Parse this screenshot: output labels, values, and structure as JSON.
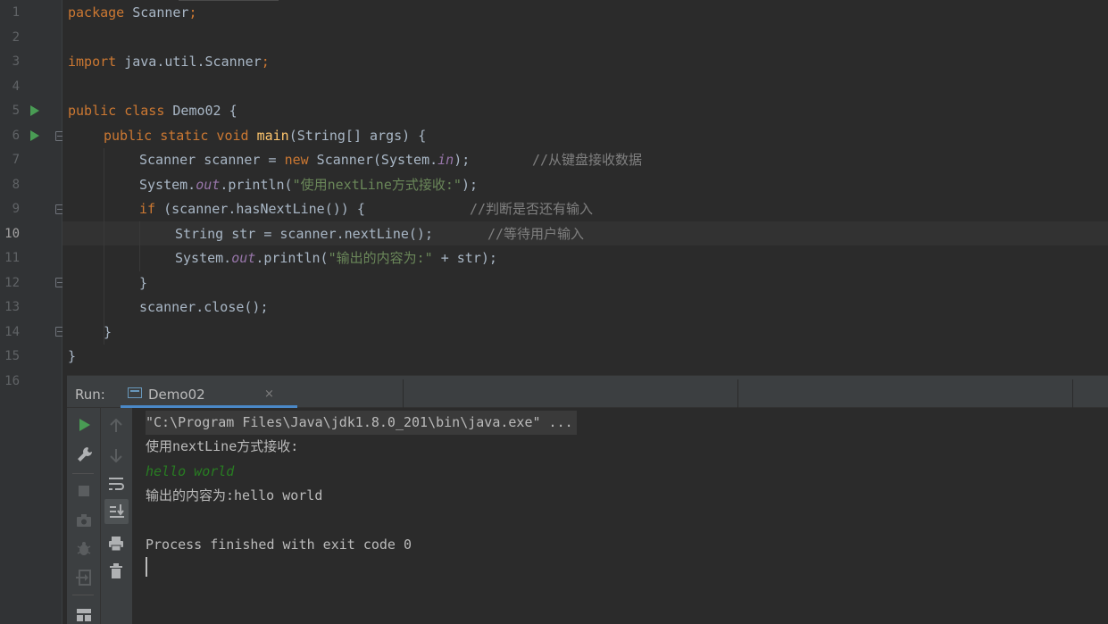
{
  "editor": {
    "line_numbers": [
      "1",
      "2",
      "3",
      "4",
      "5",
      "6",
      "7",
      "8",
      "9",
      "10",
      "11",
      "12",
      "13",
      "14",
      "15",
      "16"
    ],
    "current_line": "10",
    "lines": {
      "l1": {
        "kw": "package",
        "rest": " Scanner",
        "semi": ";"
      },
      "l3": {
        "kw": "import",
        "rest": " java.util.Scanner",
        "semi": ";"
      },
      "l5": {
        "kw": "public class",
        "rest": " Demo02 {"
      },
      "l6": {
        "kw": "public static void",
        "fn": "main",
        "rest": "(String[] args) {"
      },
      "l7": {
        "a": "Scanner scanner = ",
        "kw": "new",
        "b": " Scanner(System.",
        "fld": "in",
        "c": ");",
        "cmt": "//从键盘接收数据"
      },
      "l8": {
        "a": "System.",
        "fld": "out",
        "b": ".println(",
        "str": "\"使用nextLine方式接收:\"",
        "c": ");"
      },
      "l9": {
        "kw": "if",
        "a": " (scanner.hasNextLine()) {",
        "cmt": "//判断是否还有输入"
      },
      "l10": {
        "a": "String str = scanner.nextLine();",
        "cmt": "//等待用户输入"
      },
      "l11": {
        "a": "System.",
        "fld": "out",
        "b": ".println(",
        "str": "\"输出的内容为:\"",
        "c": " + str);"
      },
      "l12": {
        "a": "}"
      },
      "l13": {
        "a": "scanner.close();"
      },
      "l14": {
        "a": "}"
      },
      "l15": {
        "a": "}"
      }
    }
  },
  "run_panel": {
    "label": "Run:",
    "tab_label": "Demo02",
    "tab_close": "×"
  },
  "console": {
    "command": "\"C:\\Program Files\\Java\\jdk1.8.0_201\\bin\\java.exe\" ...",
    "prompt": "使用nextLine方式接收:",
    "user_input": "hello world",
    "output": "输出的内容为:hello world",
    "exit_message": "Process finished with exit code 0"
  },
  "colors": {
    "background": "#2b2b2b",
    "keyword": "#cc7832",
    "function": "#ffc66d",
    "string": "#6a8759",
    "comment": "#808080",
    "field": "#9876aa",
    "run_green": "#499c54",
    "user_input": "#287d22"
  },
  "icons": {
    "left_toolbar": [
      "rerun-icon",
      "wrench-icon",
      "stop-icon",
      "camera-icon",
      "debug-icon",
      "exit-icon",
      "layout-icon"
    ],
    "right_toolbar": [
      "up-arrow-icon",
      "down-arrow-icon",
      "soft-wrap-icon",
      "scroll-to-end-icon",
      "print-icon",
      "trash-icon"
    ]
  }
}
